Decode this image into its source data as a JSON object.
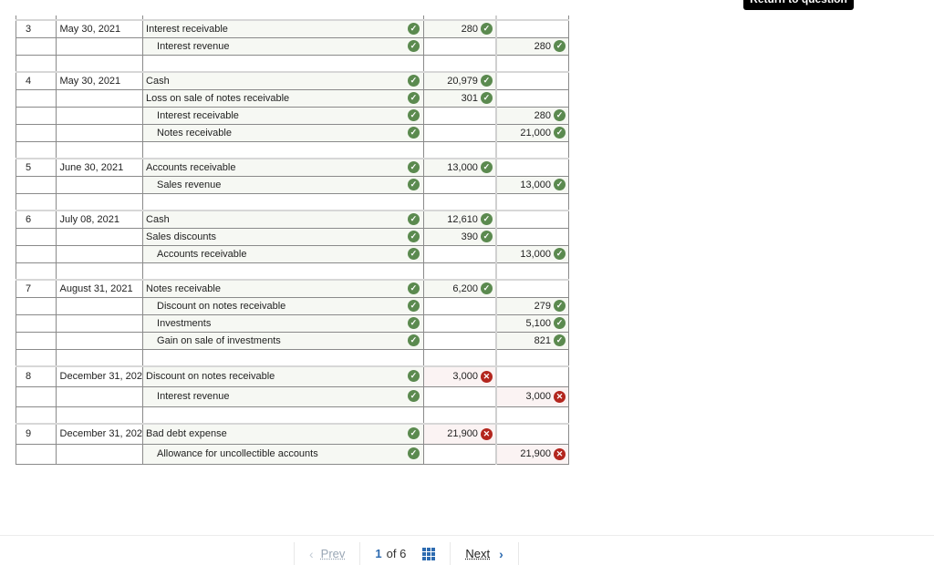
{
  "header": {
    "return_button": "Return to question"
  },
  "journal": {
    "entries": [
      {
        "no": "3",
        "date": "May 30, 2021",
        "lines": [
          {
            "account": "Interest receivable",
            "indent": false,
            "account_status": "correct",
            "debit": "280",
            "debit_status": "correct",
            "credit": "",
            "credit_status": ""
          },
          {
            "account": "Interest revenue",
            "indent": true,
            "account_status": "correct",
            "debit": "",
            "debit_status": "",
            "credit": "280",
            "credit_status": "correct"
          }
        ]
      },
      {
        "no": "4",
        "date": "May 30, 2021",
        "lines": [
          {
            "account": "Cash",
            "indent": false,
            "account_status": "correct",
            "debit": "20,979",
            "debit_status": "correct",
            "credit": "",
            "credit_status": ""
          },
          {
            "account": "Loss on sale of notes receivable",
            "indent": false,
            "account_status": "correct",
            "debit": "301",
            "debit_status": "correct",
            "credit": "",
            "credit_status": ""
          },
          {
            "account": "Interest receivable",
            "indent": true,
            "account_status": "correct",
            "debit": "",
            "debit_status": "",
            "credit": "280",
            "credit_status": "correct"
          },
          {
            "account": "Notes receivable",
            "indent": true,
            "account_status": "correct",
            "debit": "",
            "debit_status": "",
            "credit": "21,000",
            "credit_status": "correct"
          }
        ]
      },
      {
        "no": "5",
        "date": "June 30, 2021",
        "lines": [
          {
            "account": "Accounts receivable",
            "indent": false,
            "account_status": "correct",
            "debit": "13,000",
            "debit_status": "correct",
            "credit": "",
            "credit_status": ""
          },
          {
            "account": "Sales revenue",
            "indent": true,
            "account_status": "correct",
            "debit": "",
            "debit_status": "",
            "credit": "13,000",
            "credit_status": "correct"
          }
        ]
      },
      {
        "no": "6",
        "date": "July 08, 2021",
        "lines": [
          {
            "account": "Cash",
            "indent": false,
            "account_status": "correct",
            "debit": "12,610",
            "debit_status": "correct",
            "credit": "",
            "credit_status": ""
          },
          {
            "account": "Sales discounts",
            "indent": false,
            "account_status": "correct",
            "debit": "390",
            "debit_status": "correct",
            "credit": "",
            "credit_status": ""
          },
          {
            "account": "Accounts receivable",
            "indent": true,
            "account_status": "correct",
            "debit": "",
            "debit_status": "",
            "credit": "13,000",
            "credit_status": "correct"
          }
        ]
      },
      {
        "no": "7",
        "date": "August 31, 2021",
        "lines": [
          {
            "account": "Notes receivable",
            "indent": false,
            "account_status": "correct",
            "debit": "6,200",
            "debit_status": "correct",
            "credit": "",
            "credit_status": ""
          },
          {
            "account": "Discount on notes receivable",
            "indent": true,
            "account_status": "correct",
            "debit": "",
            "debit_status": "",
            "credit": "279",
            "credit_status": "correct"
          },
          {
            "account": "Investments",
            "indent": true,
            "account_status": "correct",
            "debit": "",
            "debit_status": "",
            "credit": "5,100",
            "credit_status": "correct"
          },
          {
            "account": "Gain on sale of investments",
            "indent": true,
            "account_status": "correct",
            "debit": "",
            "debit_status": "",
            "credit": "821",
            "credit_status": "correct"
          }
        ]
      },
      {
        "no": "8",
        "date": "December 31, 202",
        "tall": true,
        "lines": [
          {
            "account": "Discount on notes receivable",
            "indent": false,
            "account_status": "correct",
            "debit": "3,000",
            "debit_status": "incorrect",
            "credit": "",
            "credit_status": ""
          },
          {
            "account": "Interest revenue",
            "indent": true,
            "account_status": "correct",
            "debit": "",
            "debit_status": "",
            "credit": "3,000",
            "credit_status": "incorrect"
          }
        ]
      },
      {
        "no": "9",
        "date": "December 31, 202",
        "tall": true,
        "last": true,
        "lines": [
          {
            "account": "Bad debt expense",
            "indent": false,
            "account_status": "correct",
            "debit": "21,900",
            "debit_status": "incorrect",
            "credit": "",
            "credit_status": ""
          },
          {
            "account": "Allowance for uncollectible accounts",
            "indent": true,
            "account_status": "correct",
            "debit": "",
            "debit_status": "",
            "credit": "21,900",
            "credit_status": "incorrect"
          }
        ]
      }
    ]
  },
  "icons": {
    "correct": "✓",
    "incorrect": "✕"
  },
  "pager": {
    "prev_label": "Prev",
    "current_page": "1",
    "of_label": "of 6",
    "next_label": "Next",
    "prev_icon": "‹",
    "next_icon": "›"
  },
  "colors": {
    "correct": "#5b8a4f",
    "incorrect": "#b3261e",
    "accent": "#2d6bb0"
  }
}
